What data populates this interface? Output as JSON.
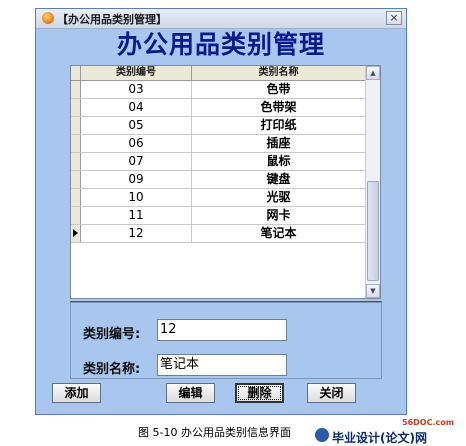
{
  "window": {
    "title": "【办公用品类别管理】",
    "close_glyph": "×"
  },
  "heading": "办公用品类别管理",
  "grid": {
    "columns": [
      "类别编号",
      "类别名称"
    ],
    "rows": [
      {
        "code": "03",
        "name": "色带"
      },
      {
        "code": "04",
        "name": "色带架"
      },
      {
        "code": "05",
        "name": "打印纸"
      },
      {
        "code": "06",
        "name": "插座"
      },
      {
        "code": "07",
        "name": "鼠标"
      },
      {
        "code": "09",
        "name": "键盘"
      },
      {
        "code": "10",
        "name": "光驱"
      },
      {
        "code": "11",
        "name": "网卡"
      },
      {
        "code": "12",
        "name": "笔记本"
      }
    ],
    "current_row_index": 8,
    "scroll_up_glyph": "▲",
    "scroll_down_glyph": "▼"
  },
  "form": {
    "code_label": "类别编号:",
    "code_value": "12",
    "name_label": "类别名称:",
    "name_value": "笔记本"
  },
  "buttons": {
    "add": "添加",
    "edit": "编辑",
    "delete": "删除",
    "close": "关闭"
  },
  "caption": "图 5-10 办公用品类别信息界面",
  "brand": {
    "site": "56DOC.com",
    "name": "毕业设计(论文)网"
  },
  "colors": {
    "window_bg": "#a9c7ee",
    "heading": "#0b1a8a"
  },
  "icons": {
    "app": "orange-ball-icon",
    "row_pointer": "row-pointer-icon"
  }
}
